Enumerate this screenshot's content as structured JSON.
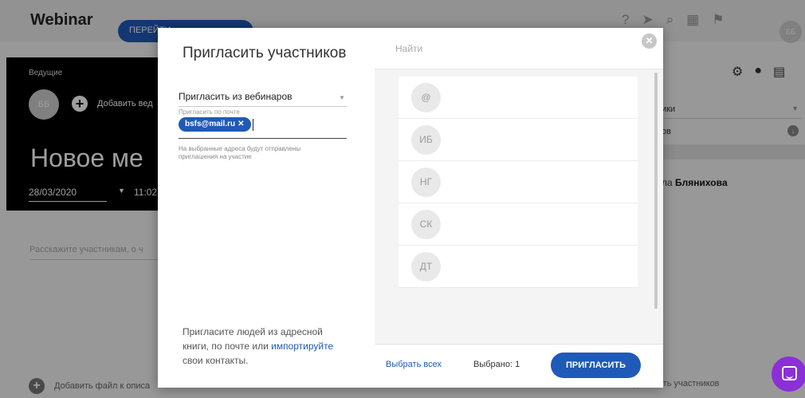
{
  "bg": {
    "logo": "Webinar",
    "goto_button": "ПЕРЕЙТИ",
    "avatar_initials": "ББ",
    "hosts_label": "Ведущие",
    "host_initials": "ББ",
    "add_host": "Добавить вед",
    "event_title": "Новое ме",
    "date": "28/03/2020",
    "time": "11:02",
    "desc_placeholder": "Расскажите участникам, о ч",
    "add_file": "Добавить файл к описа",
    "right_a": "ики",
    "right_b": "ов",
    "right_name_prefix": "ла ",
    "right_name_bold": "Бляниховa",
    "add_participants": "добавить участников"
  },
  "modal": {
    "title": "Пригласить участников",
    "source_select": "Пригласить из вебинаров",
    "email_label": "Пригласить по почте",
    "chips": [
      "bsfs@mail.ru"
    ],
    "hint": "На выбранные адреса будут отправлены приглашения на участие",
    "bottom_text": "Пригласите людей из адресной книги, по почте или ",
    "bottom_link": "импортируйте",
    "bottom_text_end": " свои контакты.",
    "search_placeholder": "Найти",
    "contacts": [
      {
        "initials": "@"
      },
      {
        "initials": "ИБ"
      },
      {
        "initials": "НГ"
      },
      {
        "initials": "СК"
      },
      {
        "initials": "ДТ"
      }
    ],
    "select_all": "Выбрать всех",
    "selected_count": "Выбрано: 1",
    "invite_button": "ПРИГЛАСИТЬ"
  },
  "icons": {
    "close": "close-icon",
    "chat": "chat-icon"
  },
  "colors": {
    "accent": "#1f5ab8",
    "chat": "#8b2fd6"
  }
}
